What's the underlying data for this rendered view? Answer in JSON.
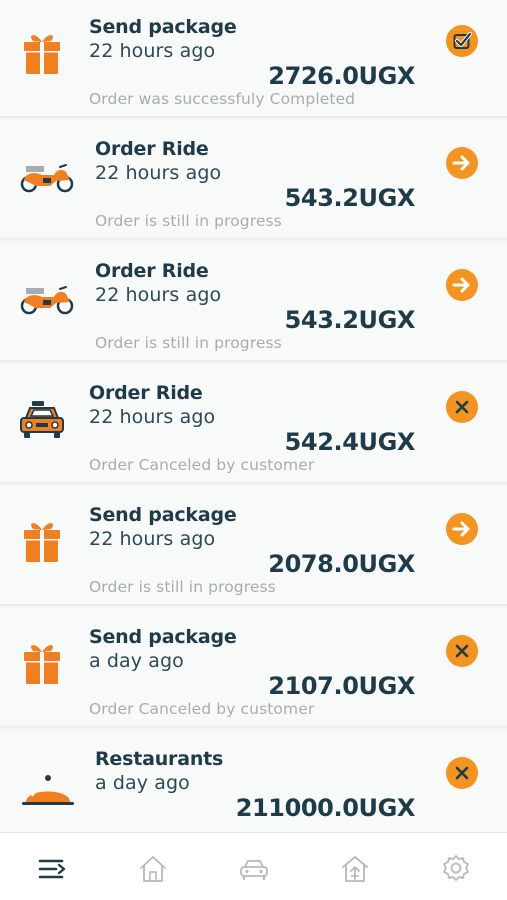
{
  "orders": [
    {
      "title": "Send package",
      "time": "22 hours ago",
      "amount": "2726.0UGX",
      "status": "Order was successfuly Completed",
      "icon": "gift-icon",
      "action_icon": "check-icon"
    },
    {
      "title": "Order Ride",
      "time": "22 hours ago",
      "amount": "543.2UGX",
      "status": "Order is still in progress",
      "icon": "motorcycle-icon",
      "action_icon": "arrow-right-icon"
    },
    {
      "title": "Order Ride",
      "time": "22 hours ago",
      "amount": "543.2UGX",
      "status": "Order is still in progress",
      "icon": "motorcycle-icon",
      "action_icon": "arrow-right-icon"
    },
    {
      "title": "Order Ride",
      "time": "22 hours ago",
      "amount": "542.4UGX",
      "status": "Order Canceled by customer",
      "icon": "taxi-icon",
      "action_icon": "close-icon"
    },
    {
      "title": "Send package",
      "time": "22 hours ago",
      "amount": "2078.0UGX",
      "status": "Order is still in progress",
      "icon": "gift-icon",
      "action_icon": "arrow-right-icon"
    },
    {
      "title": "Send package",
      "time": "a day ago",
      "amount": "2107.0UGX",
      "status": "Order Canceled by customer",
      "icon": "gift-icon",
      "action_icon": "close-icon"
    },
    {
      "title": "Restaurants",
      "time": "a day ago",
      "amount": "211000.0UGX",
      "status": "",
      "icon": "food-cloche-icon",
      "action_icon": "close-icon"
    }
  ],
  "tabbar": {
    "items": [
      {
        "icon": "menu-icon",
        "active": true
      },
      {
        "icon": "home-icon",
        "active": false
      },
      {
        "icon": "car-icon",
        "active": false
      },
      {
        "icon": "upload-home-icon",
        "active": false
      },
      {
        "icon": "gear-icon",
        "active": false
      }
    ]
  },
  "colors": {
    "accent": "#f39322",
    "title_text": "#1f3b4a",
    "status_text": "#a6adb1",
    "background": "#f8f9f9",
    "tab_active": "#1f3b4a",
    "tab_inactive": "#b5babd"
  }
}
